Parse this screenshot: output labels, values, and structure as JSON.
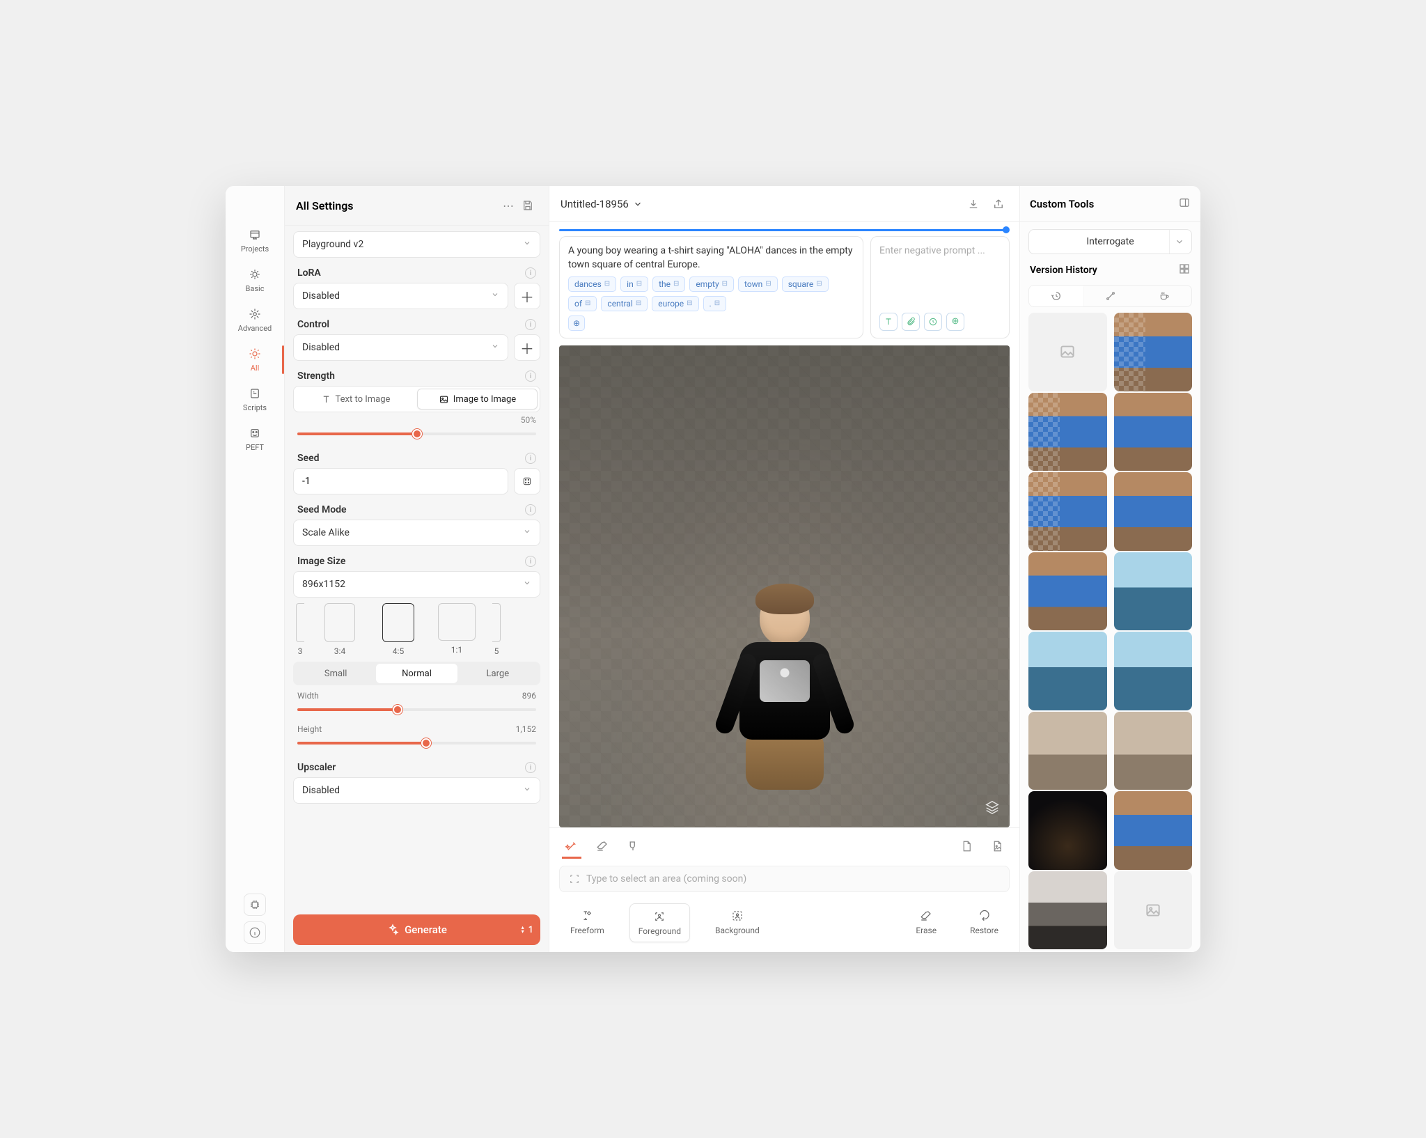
{
  "rail": {
    "projects": "Projects",
    "basic": "Basic",
    "advanced": "Advanced",
    "all": "All",
    "scripts": "Scripts",
    "peft": "PEFT"
  },
  "settings": {
    "title": "All Settings",
    "model_value": "Playground v2",
    "lora": {
      "label": "LoRA",
      "value": "Disabled"
    },
    "control": {
      "label": "Control",
      "value": "Disabled"
    },
    "strength": {
      "label": "Strength",
      "text_opt": "Text to Image",
      "image_opt": "Image to Image",
      "pct": "50%"
    },
    "seed": {
      "label": "Seed",
      "value": "-1"
    },
    "seed_mode": {
      "label": "Seed Mode",
      "value": "Scale Alike"
    },
    "image_size": {
      "label": "Image Size",
      "value": "896x1152"
    },
    "ratios": {
      "r3": "3",
      "r34": "3:4",
      "r45": "4:5",
      "r11": "1:1",
      "r5": "5"
    },
    "size_seg": {
      "small": "Small",
      "normal": "Normal",
      "large": "Large"
    },
    "width": {
      "label": "Width",
      "value": "896"
    },
    "height": {
      "label": "Height",
      "value": "1,152"
    },
    "upscaler": {
      "label": "Upscaler",
      "value": "Disabled"
    },
    "generate": "Generate",
    "gen_count": "1"
  },
  "center": {
    "title": "Untitled-18956",
    "prompt": "A young boy wearing a t-shirt saying \"ALOHA\" dances in the empty town square of central Europe.",
    "neg_placeholder": "Enter negative prompt ...",
    "chips": [
      "dances",
      "in",
      "the",
      "empty",
      "town",
      "square",
      "of",
      "central",
      "europe",
      "."
    ],
    "area_placeholder": "Type to select an area (coming soon)",
    "tools": {
      "freeform": "Freeform",
      "foreground": "Foreground",
      "background": "Background",
      "erase": "Erase",
      "restore": "Restore"
    }
  },
  "right": {
    "title": "Custom Tools",
    "interrogate": "Interrogate",
    "version_history": "Version History"
  }
}
